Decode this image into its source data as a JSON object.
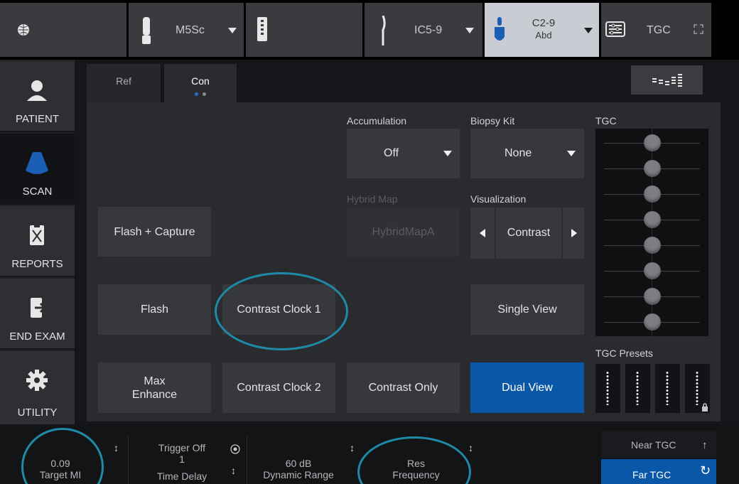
{
  "probes": [
    {
      "name": "M5Sc"
    },
    {
      "name": "IC5-9"
    },
    {
      "name": "C2-9",
      "preset": "Abd"
    },
    {
      "name": "TGC"
    }
  ],
  "nav": {
    "items": [
      {
        "label": "PATIENT",
        "icon": "patient-icon"
      },
      {
        "label": "SCAN",
        "icon": "scan-icon"
      },
      {
        "label": "REPORTS",
        "icon": "reports-icon"
      },
      {
        "label": "END EXAM",
        "icon": "end-exam-icon"
      },
      {
        "label": "UTILITY",
        "icon": "gear-icon"
      }
    ]
  },
  "tabs": [
    {
      "label": "Ref"
    },
    {
      "label": "Con"
    }
  ],
  "controls": {
    "flash_capture": "Flash + Capture",
    "flash": "Flash",
    "contrast_clock_1": "Contrast Clock 1",
    "max_enhance": "Max\nEnhance",
    "contrast_clock_2": "Contrast Clock 2",
    "contrast_only": "Contrast Only",
    "single_view": "Single View",
    "dual_view": "Dual View",
    "accumulation_label": "Accumulation",
    "accumulation_value": "Off",
    "biopsy_label": "Biopsy Kit",
    "biopsy_value": "None",
    "hybrid_label": "Hybrid Map",
    "hybrid_value": "HybridMapA",
    "visualization_label": "Visualization",
    "visualization_value": "Contrast",
    "tgc_label": "TGC",
    "tgc_presets_label": "TGC Presets"
  },
  "bottom": {
    "target_mi_value": "0.09",
    "target_mi_label": "Target MI",
    "trigger_label": "Trigger Off",
    "time_delay_value": "1",
    "time_delay_label": "Time Delay",
    "dynamic_range_value": "60 dB",
    "dynamic_range_label": "Dynamic Range",
    "frequency_value": "Res",
    "frequency_label": "Frequency",
    "near_tgc": "Near TGC",
    "far_tgc": "Far TGC"
  },
  "colors": {
    "accent_blue": "#0a57a8",
    "highlight_ring": "#1e8aa8",
    "tab_dot_active": "#1e6fd0",
    "tab_dot_inactive": "#8a8c90"
  }
}
